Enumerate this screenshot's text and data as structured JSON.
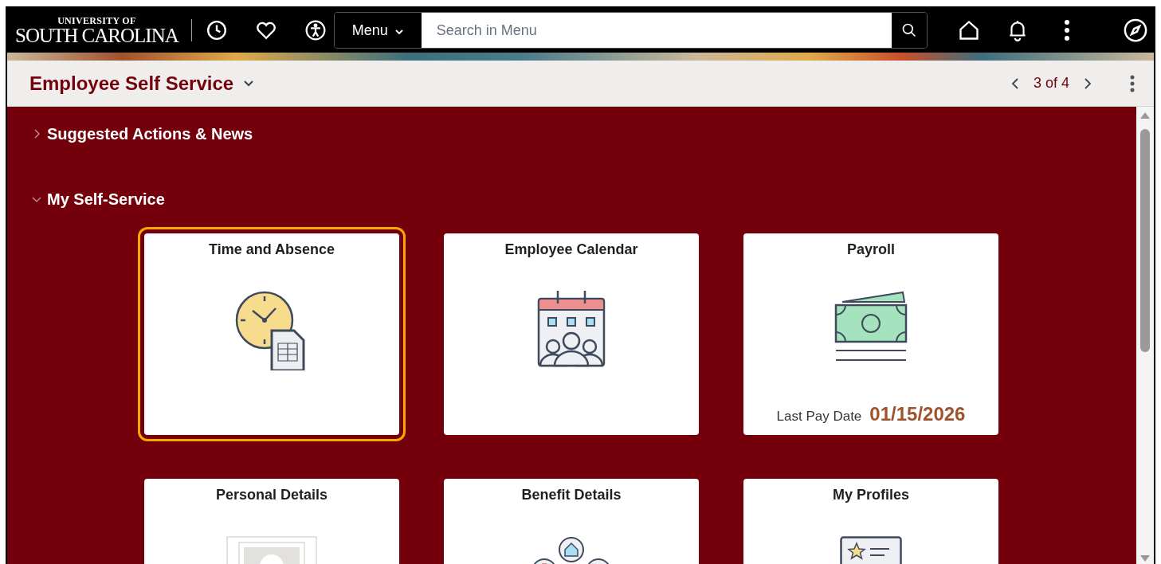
{
  "header": {
    "logo": {
      "line_1": "UNIVERSITY OF",
      "line_2": "SOUTH CAROLINA"
    },
    "menu_button": "Menu",
    "search": {
      "placeholder": "Search in Menu"
    }
  },
  "title_bar": {
    "title": "Employee Self Service",
    "pager": "3 of 4"
  },
  "sections": [
    {
      "title": "Suggested Actions & News",
      "expanded": false
    },
    {
      "title": "My Self-Service",
      "expanded": true,
      "tiles": [
        {
          "kind": "time",
          "title": "Time and Absence",
          "selected": true
        },
        {
          "kind": "calendar",
          "title": "Employee Calendar",
          "selected": false
        },
        {
          "kind": "payroll",
          "title": "Payroll",
          "selected": false,
          "footer_label": "Last Pay Date",
          "footer_value": "01/15/2026"
        },
        {
          "kind": "personal",
          "title": "Personal Details",
          "selected": false
        },
        {
          "kind": "benefit",
          "title": "Benefit Details",
          "selected": false
        },
        {
          "kind": "profiles",
          "title": "My Profiles",
          "selected": false
        }
      ]
    }
  ]
}
